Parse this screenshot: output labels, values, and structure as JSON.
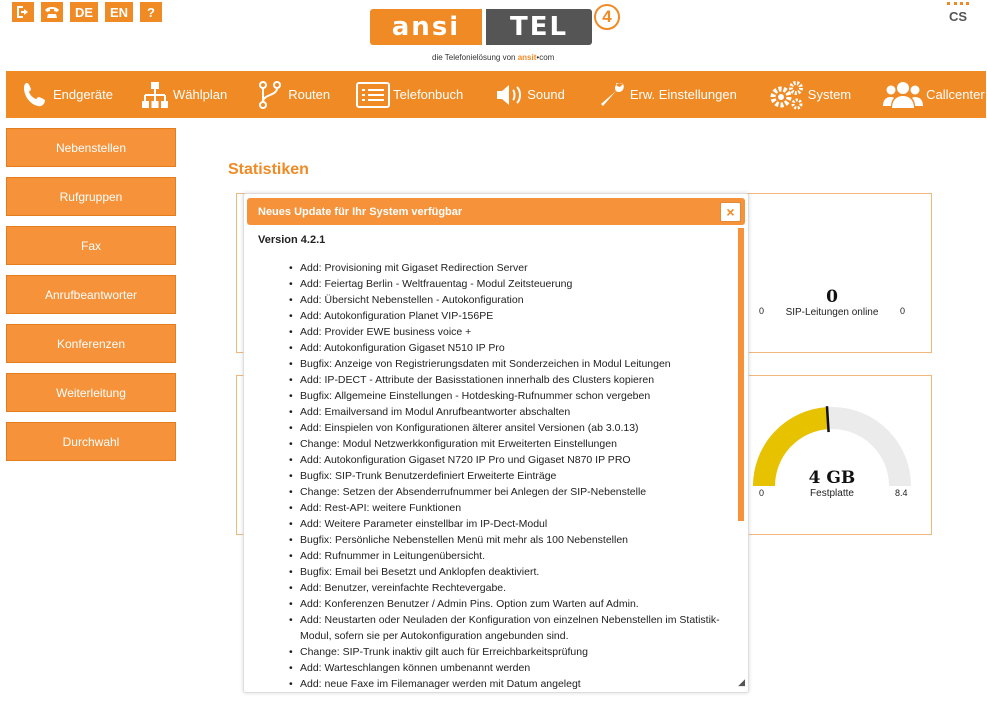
{
  "topbar": {
    "lang_de": "DE",
    "lang_en": "EN",
    "help": "?",
    "cs_badge": "CS"
  },
  "logo": {
    "ansi": "ansi",
    "tel": "TEL",
    "number": "4",
    "subtitle_prefix": "die Telefonielösung von",
    "subtitle_brand": "ansit",
    "subtitle_suffix": "com"
  },
  "nav": [
    {
      "label": "Endgeräte",
      "icon": "phone-icon"
    },
    {
      "label": "Wählplan",
      "icon": "hierarchy-icon"
    },
    {
      "label": "Routen",
      "icon": "route-icon"
    },
    {
      "label": "Telefonbuch",
      "icon": "list-icon"
    },
    {
      "label": "Sound",
      "icon": "speaker-icon"
    },
    {
      "label": "Erw. Einstellungen",
      "icon": "wrench-icon"
    },
    {
      "label": "System",
      "icon": "gears-icon"
    },
    {
      "label": "Callcenter",
      "icon": "users-icon"
    }
  ],
  "sidebar": [
    {
      "label": "Nebenstellen"
    },
    {
      "label": "Rufgruppen"
    },
    {
      "label": "Fax"
    },
    {
      "label": "Anrufbeantworter"
    },
    {
      "label": "Konferenzen"
    },
    {
      "label": "Weiterleitung"
    },
    {
      "label": "Durchwahl"
    }
  ],
  "page": {
    "title": "Statistiken"
  },
  "stats": {
    "sip": {
      "value": "0",
      "label": "SIP-Leitungen online",
      "min": "0",
      "max": "0"
    },
    "disk": {
      "value": "4 GB",
      "label": "Festplatte",
      "min": "0",
      "max": "8.4",
      "fill_fraction": 0.48
    }
  },
  "colors": {
    "accent": "#f08a24",
    "gauge_fill": "#e6c200",
    "gauge_track": "#ebebeb"
  },
  "modal": {
    "title": "Neues Update für Ihr System verfügbar",
    "close": "×",
    "version": "Version 4.2.1",
    "entries": [
      "Add: Provisioning mit Gigaset Redirection Server",
      "Add: Feiertag Berlin - Weltfrauentag - Modul Zeitsteuerung",
      "Add: Übersicht Nebenstellen - Autokonfiguration",
      "Add: Autokonfiguration Planet VIP-156PE",
      "Add: Provider EWE business voice +",
      "Add: Autokonfiguration Gigaset N510 IP Pro",
      "Bugfix: Anzeige von Registrierungsdaten mit Sonderzeichen in Modul Leitungen",
      "Add: IP-DECT - Attribute der Basisstationen innerhalb des Clusters kopieren",
      "Bugfix: Allgemeine Einstellungen - Hotdesking-Rufnummer schon vergeben",
      "Add: Emailversand im Modul Anrufbeantworter abschalten",
      "Add: Einspielen von Konfigurationen älterer ansitel Versionen (ab 3.0.13)",
      "Change: Modul Netzwerkkonfiguration mit Erweiterten Einstellungen",
      "Add: Autokonfiguration Gigaset N720 IP Pro und Gigaset N870 IP PRO",
      "Bugfix: SIP-Trunk Benutzerdefiniert Erweiterte Einträge",
      "Change: Setzen der Absenderrufnummer bei Anlegen der SIP-Nebenstelle",
      "Add: Rest-API: weitere Funktionen",
      "Add: Weitere Parameter einstellbar im IP-Dect-Modul",
      "Bugfix: Persönliche Nebenstellen Menü mit mehr als 100 Nebenstellen",
      "Add: Rufnummer in Leitungenübersicht.",
      "Bugfix: Email bei Besetzt und Anklopfen deaktiviert.",
      "Add: Benutzer, vereinfachte Rechtevergabe.",
      "Add: Konferenzen Benutzer / Admin Pins. Option zum Warten auf Admin.",
      "Add: Neustarten oder Neuladen der Konfiguration von einzelnen Nebenstellen im Statistik-Modul, sofern sie per Autokonfiguration angebunden sind.",
      "Change: SIP-Trunk inaktiv gilt auch für Erreichbarkeitsprüfung",
      "Add: Warteschlangen können umbenannt werden",
      "Add: neue Faxe im Filemanager werden mit Datum angelegt"
    ]
  }
}
